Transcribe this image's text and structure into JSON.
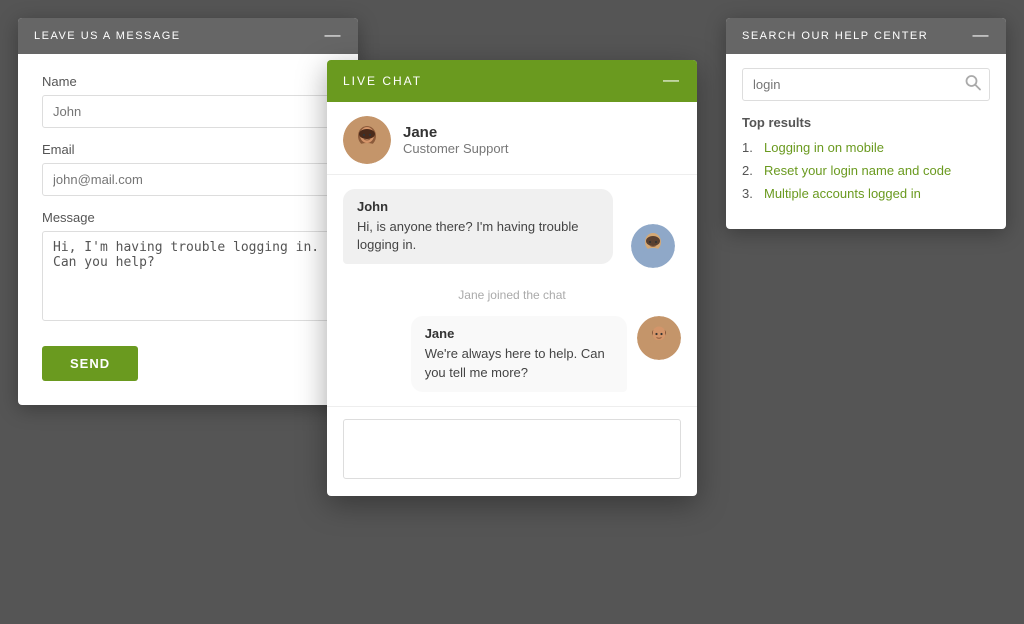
{
  "leave_message": {
    "header": "LEAVE US A MESSAGE",
    "minimize": "—",
    "name_label": "Name",
    "name_placeholder": "John",
    "email_label": "Email",
    "email_placeholder": "john@mail.com",
    "message_label": "Message",
    "message_value": "Hi, I'm having trouble logging in. Can you help?",
    "send_button": "SEND"
  },
  "search": {
    "header": "SEARCH OUR HELP CENTER",
    "minimize": "—",
    "placeholder": "login",
    "top_results_label": "Top results",
    "results": [
      {
        "num": "1.",
        "text": "Logging in on mobile"
      },
      {
        "num": "2.",
        "text": "Reset your login name and code"
      },
      {
        "num": "3.",
        "text": "Multiple accounts logged in"
      }
    ]
  },
  "live_chat": {
    "header": "LIVE CHAT",
    "minimize": "—",
    "agent_name": "Jane",
    "agent_role": "Customer Support",
    "system_msg": "Jane joined the chat",
    "messages": [
      {
        "sender": "John",
        "text": "Hi, is anyone there? I'm having trouble logging in."
      },
      {
        "sender": "Jane",
        "text": "We're always here to help. Can you tell me more?"
      }
    ],
    "input_placeholder": ""
  }
}
